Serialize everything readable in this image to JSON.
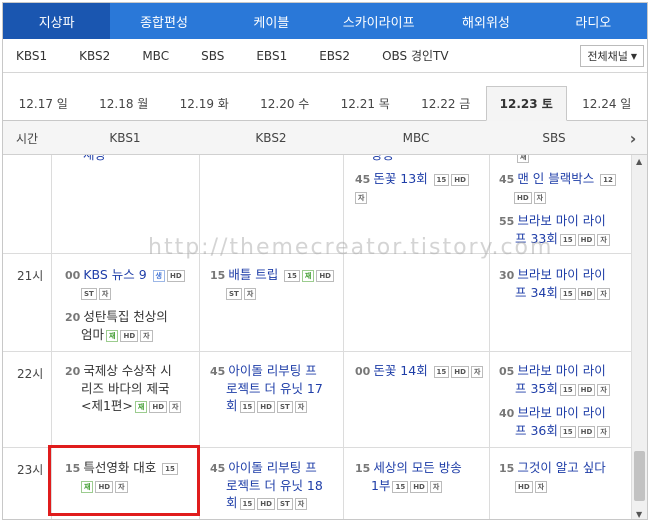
{
  "category_tabs": [
    "지상파",
    "종합편성",
    "케이블",
    "스카이라이프",
    "해외위성",
    "라디오"
  ],
  "channels": [
    "KBS1",
    "KBS2",
    "MBC",
    "SBS",
    "EBS1",
    "EBS2",
    "OBS 경인TV"
  ],
  "channel_select": "전체채널",
  "dates": [
    "12.17 일",
    "12.18 월",
    "12.19 화",
    "12.20 수",
    "12.21 목",
    "12.22 금",
    "12.23 토",
    "12.24 일"
  ],
  "active_date": "12.23 토",
  "schedule_header": [
    "시간",
    "KBS1",
    "KBS2",
    "MBC",
    "SBS"
  ],
  "times": [
    "21시",
    "22시",
    "23시"
  ],
  "watermark": "http://themecreator.tistory.com",
  "programs": {
    "c1_top": {
      "title_partial": "재방"
    },
    "c3_top": {
      "title_partial": "방송"
    },
    "c4_top": {
      "badge": "재"
    },
    "mbc_45": {
      "min": "45",
      "title": "돈꽃 13회",
      "b1": "15",
      "b2": "HD",
      "b3": "자"
    },
    "sbs_45": {
      "min": "45",
      "title": "맨 인 블랙박스",
      "b1": "12",
      "b2": "HD",
      "b3": "자"
    },
    "sbs_55": {
      "min": "55",
      "title1": "브라보 마이 라이",
      "title2": "프 33회",
      "b1": "15",
      "b2": "HD",
      "b3": "자"
    },
    "kbs1_00": {
      "min": "00",
      "title": "KBS 뉴스 9",
      "b1": "생",
      "b2": "HD",
      "b3": "ST",
      "b4": "자"
    },
    "kbs1_20": {
      "min": "20",
      "title1": "성탄특집 천상의",
      "title2": "엄마",
      "b1": "재",
      "b2": "HD",
      "b3": "자"
    },
    "kbs2_15": {
      "min": "15",
      "title": "배틀 트립",
      "b1": "15",
      "b2": "재",
      "b3": "HD",
      "b4": "ST",
      "b5": "자"
    },
    "sbs_30": {
      "min": "30",
      "title1": "브라보 마이 라이",
      "title2": "프 34회",
      "b1": "15",
      "b2": "HD",
      "b3": "자"
    },
    "kbs1_22_20": {
      "min": "20",
      "title1": "국제상 수상작 시",
      "title2": "리즈 바다의 제국",
      "title3": "<제1편>",
      "b1": "재",
      "b2": "HD",
      "b3": "자"
    },
    "kbs2_22_45": {
      "min": "45",
      "title1": "아이돌 리부팅 프",
      "title2": "로젝트 더 유닛 17",
      "title3": "회",
      "b1": "15",
      "b2": "HD",
      "b3": "ST",
      "b4": "자"
    },
    "mbc_22_00": {
      "min": "00",
      "title": "돈꽃 14회",
      "b1": "15",
      "b2": "HD",
      "b3": "자"
    },
    "sbs_22_05": {
      "min": "05",
      "title1": "브라보 마이 라이",
      "title2": "프 35회",
      "b1": "15",
      "b2": "HD",
      "b3": "자"
    },
    "sbs_22_40": {
      "min": "40",
      "title1": "브라보 마이 라이",
      "title2": "프 36회",
      "b1": "15",
      "b2": "HD",
      "b3": "자"
    },
    "kbs1_23_15": {
      "min": "15",
      "title": "특선영화 대호",
      "b1": "15",
      "b2": "재",
      "b3": "HD",
      "b4": "자"
    },
    "kbs2_23_45": {
      "min": "45",
      "title1": "아이돌 리부팅 프",
      "title2": "로젝트 더 유닛 18",
      "title3": "회",
      "b1": "15",
      "b2": "HD",
      "b3": "ST",
      "b4": "자"
    },
    "mbc_23_15": {
      "min": "15",
      "title1": "세상의 모든 방송",
      "title2": "1부",
      "b1": "15",
      "b2": "HD",
      "b3": "자"
    },
    "sbs_23_15": {
      "min": "15",
      "title": "그것이 알고 싶다",
      "b1": "HD",
      "b2": "자"
    }
  }
}
